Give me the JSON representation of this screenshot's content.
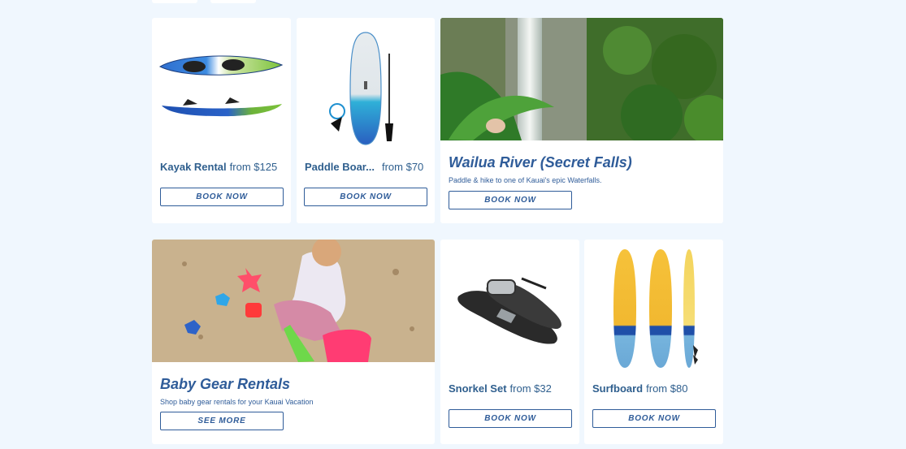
{
  "colors": {
    "page_bg": "#f0f7fe",
    "card_bg": "#ffffff",
    "brand_blue": "#2f5c99",
    "text_blue": "#2f5f8e"
  },
  "row1": {
    "kayak": {
      "name": "Kayak Rental",
      "price": "from $125",
      "button": "BOOK NOW",
      "image": "kayak-image"
    },
    "paddle": {
      "name": "Paddle Boar...",
      "price": "from $70",
      "button": "BOOK NOW",
      "image": "paddle-board-image"
    },
    "wailua": {
      "title": "Wailua River (Secret Falls)",
      "subtitle": "Paddle & hike to one of Kauai's epic Waterfalls.",
      "button": "BOOK NOW",
      "image": "waterfall-photo"
    }
  },
  "row2": {
    "baby": {
      "title": "Baby Gear Rentals",
      "subtitle": "Shop baby gear rentals for your Kauai Vacation",
      "button": "SEE MORE",
      "image": "beach-toddler-photo"
    },
    "snorkel": {
      "name": "Snorkel Set",
      "price": "from $32",
      "button": "BOOK NOW",
      "image": "snorkel-image"
    },
    "surf": {
      "name": "Surfboard",
      "price": "from $80",
      "button": "BOOK NOW",
      "image": "surfboard-image"
    }
  }
}
